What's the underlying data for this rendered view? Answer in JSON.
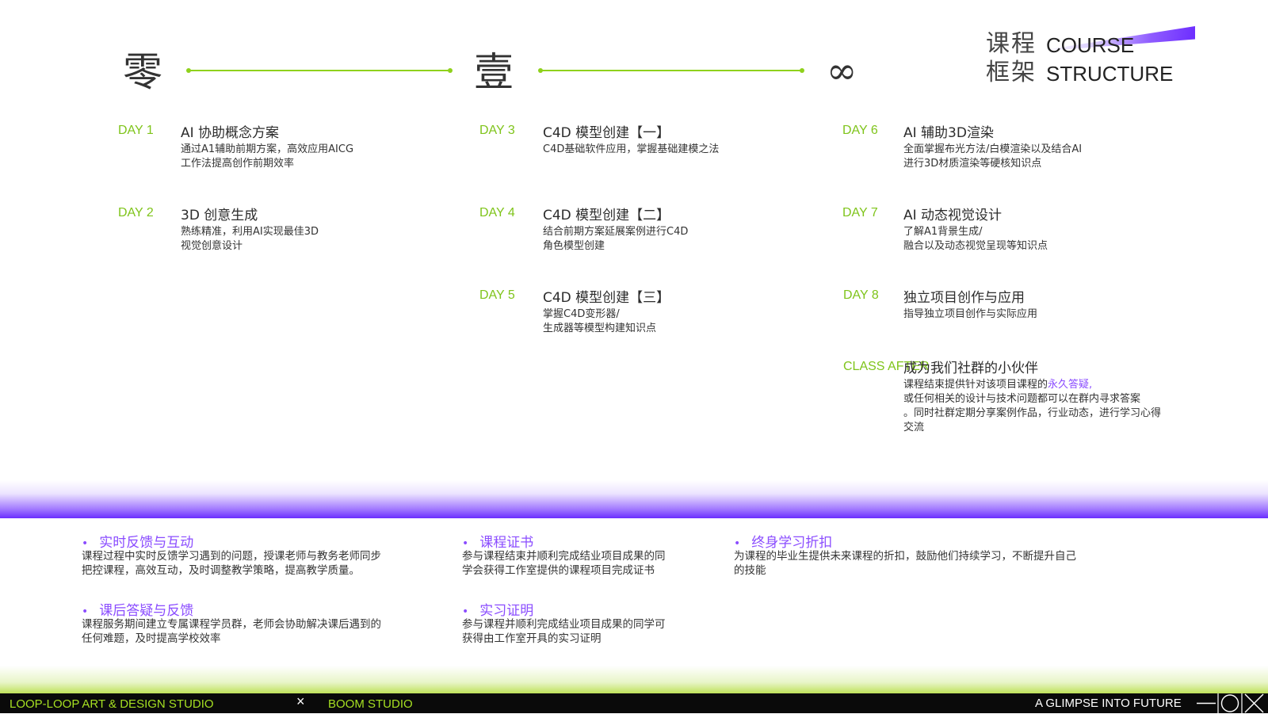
{
  "header": {
    "title_cn_line1": "课程",
    "title_cn_line2": "框架",
    "title_en_line1": "COURSE",
    "title_en_line2": "STRUCTURE"
  },
  "stages": [
    "零",
    "壹",
    "∞"
  ],
  "schedule": {
    "day1": {
      "label": "DAY 1",
      "title": "AI 协助概念方案",
      "desc": [
        "通过A1辅助前期方案，高效应用AICG",
        "工作法提高创作前期效率"
      ]
    },
    "day2": {
      "label": "DAY 2",
      "title": "3D 创意生成",
      "desc": [
        "熟练精准，利用AI实现最佳3D",
        "视觉创意设计"
      ]
    },
    "day3": {
      "label": "DAY 3",
      "title": "C4D 模型创建【一】",
      "desc": [
        "C4D基础软件应用，掌握基础建模之法"
      ]
    },
    "day4": {
      "label": "DAY 4",
      "title": "C4D 模型创建【二】",
      "desc": [
        "结合前期方案延展案例进行C4D",
        "角色模型创建"
      ]
    },
    "day5": {
      "label": "DAY 5",
      "title": "C4D 模型创建【三】",
      "desc": [
        "掌握C4D变形器/",
        "生成器等模型构建知识点"
      ]
    },
    "day6": {
      "label": "DAY 6",
      "title": "AI 辅助3D渲染",
      "desc": [
        "全面掌握布光方法/白模渲染以及结合AI",
        "进行3D材质渲染等硬核知识点"
      ]
    },
    "day7": {
      "label": "DAY 7",
      "title": "AI 动态视觉设计",
      "desc": [
        "了解A1背景生成/",
        "融合以及动态视觉呈现等知识点"
      ]
    },
    "day8": {
      "label": "DAY 8",
      "title": "独立项目创作与应用",
      "desc": [
        "指导独立项目创作与实际应用"
      ]
    },
    "after": {
      "label": "CLASS AFTER",
      "title": "成为我们社群的小伙伴",
      "desc_prefix": "课程结束提供针对该项目课程的",
      "desc_highlight": "永久答疑,",
      "desc_rest": [
        "或任何相关的设计与技术问题都可以在群内寻求答案",
        "。同时社群定期分享案例作品，行业动态，进行学习心得",
        "交流"
      ]
    }
  },
  "benefits": {
    "b1": {
      "title": "实时反馈与互动",
      "desc": [
        "课程过程中实时反馈学习遇到的问题，授课老师与教务老师同步",
        "把控课程，高效互动，及时调整教学策略，提高教学质量。"
      ]
    },
    "b2": {
      "title": "课后答疑与反馈",
      "desc": [
        "课程服务期间建立专属课程学员群，老师会协助解决课后遇到的",
        "任何难题，及时提高学校效率"
      ]
    },
    "b3": {
      "title": "课程证书",
      "desc": [
        "参与课程结束并顺利完成结业项目成果的同",
        "学会获得工作室提供的课程项目完成证书"
      ]
    },
    "b4": {
      "title": "实习证明",
      "desc": [
        "参与课程并顺利完成结业项目成果的同学可",
        "获得由工作室开具的实习证明"
      ]
    },
    "b5": {
      "title": "终身学习折扣",
      "desc": [
        "为课程的毕业生提供未来课程的折扣，鼓励他们持续学习，不断提升自己",
        "的技能"
      ]
    },
    "bullet": "•"
  },
  "footer": {
    "left": "LOOP-LOOP ART & DESIGN STUDIO",
    "cross": "×",
    "middle": "BOOM STUDIO",
    "right": "A GLIMPSE INTO FUTURE"
  },
  "colors": {
    "accent_green": "#8fd11c",
    "accent_purple": "#8b4dff",
    "footer_bg": "#0a0a0a"
  }
}
